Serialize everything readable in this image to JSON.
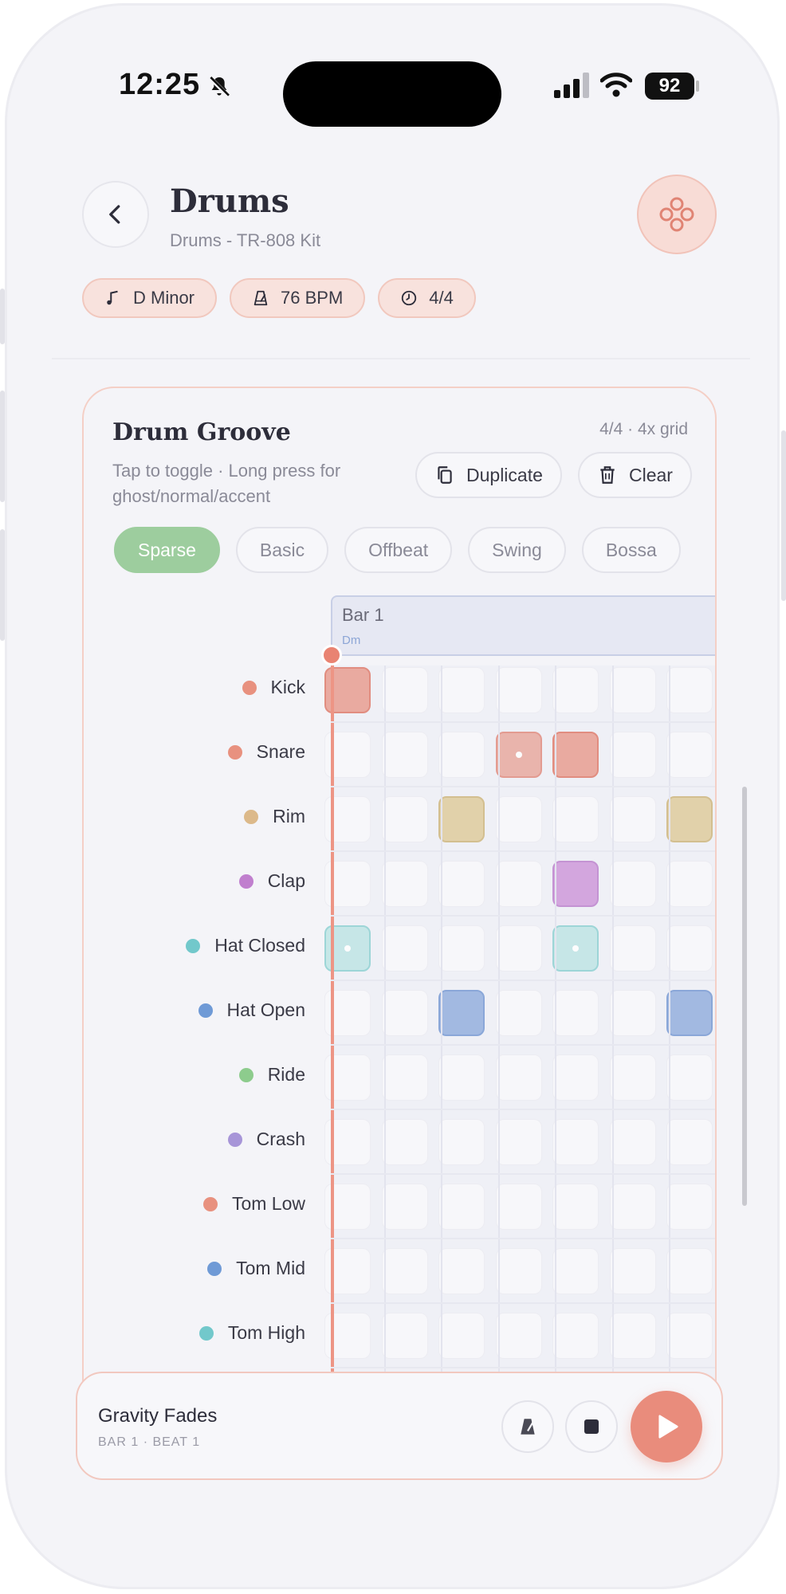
{
  "status_bar": {
    "time": "12:25",
    "battery": "92"
  },
  "header": {
    "title": "Drums",
    "subtitle": "Drums - TR-808 Kit",
    "chips": [
      {
        "label": "D Minor",
        "icon": "music-note-icon"
      },
      {
        "label": "76 BPM",
        "icon": "metronome-icon"
      },
      {
        "label": "4/4",
        "icon": "clock-icon"
      }
    ]
  },
  "card": {
    "title": "Drum Groove",
    "grid_info": "4/4 · 4x grid",
    "hint": "Tap to toggle · Long press for ghost/normal/accent",
    "duplicate_label": "Duplicate",
    "clear_label": "Clear",
    "presets": [
      "Sparse",
      "Basic",
      "Offbeat",
      "Swing",
      "Bossa"
    ],
    "active_preset": "Sparse",
    "bar": {
      "label": "Bar 1",
      "chord": "Dm"
    }
  },
  "tracks": [
    {
      "name": "Kick",
      "color": "#e8917f",
      "fill": "#e9aaa0",
      "stroke": "#e18d80"
    },
    {
      "name": "Snare",
      "color": "#e8917f",
      "fill": "#e9aaa0",
      "stroke": "#e18d80"
    },
    {
      "name": "Rim",
      "color": "#dcb98a",
      "fill": "#e1d1aa",
      "stroke": "#d3bf90"
    },
    {
      "name": "Clap",
      "color": "#c07fce",
      "fill": "#d3a6de",
      "stroke": "#c493d3"
    },
    {
      "name": "Hat Closed",
      "color": "#72c8cb",
      "fill": "#bfe5e5",
      "stroke": "#8fd1d2"
    },
    {
      "name": "Hat Open",
      "color": "#6f9ad6",
      "fill": "#a2b9e1",
      "stroke": "#8aa7d8"
    },
    {
      "name": "Ride",
      "color": "#8dcc8d",
      "fill": "#bfe1bf",
      "stroke": "#9fd29f"
    },
    {
      "name": "Crash",
      "color": "#a795d8",
      "fill": "#c9bde8",
      "stroke": "#b2a3dc"
    },
    {
      "name": "Tom Low",
      "color": "#e8917f",
      "fill": "#e9aaa0",
      "stroke": "#e18d80"
    },
    {
      "name": "Tom Mid",
      "color": "#6f9ad6",
      "fill": "#a2b9e1",
      "stroke": "#8aa7d8"
    },
    {
      "name": "Tom High",
      "color": "#72c8cb",
      "fill": "#bfe5e5",
      "stroke": "#8fd1d2"
    }
  ],
  "pattern": [
    [
      2,
      0,
      0,
      0,
      0,
      0,
      0
    ],
    [
      0,
      0,
      0,
      1,
      2,
      0,
      0
    ],
    [
      0,
      0,
      2,
      0,
      0,
      0,
      2
    ],
    [
      0,
      0,
      0,
      0,
      2,
      0,
      0
    ],
    [
      1,
      0,
      0,
      0,
      1,
      0,
      0
    ],
    [
      0,
      0,
      2,
      0,
      0,
      0,
      2
    ],
    [
      0,
      0,
      0,
      0,
      0,
      0,
      0
    ],
    [
      0,
      0,
      0,
      0,
      0,
      0,
      0
    ],
    [
      0,
      0,
      0,
      0,
      0,
      0,
      0
    ],
    [
      0,
      0,
      0,
      0,
      0,
      0,
      0
    ],
    [
      0,
      0,
      0,
      0,
      0,
      0,
      0
    ]
  ],
  "transport": {
    "song_title": "Gravity Fades",
    "position": "BAR 1 · BEAT 1"
  }
}
